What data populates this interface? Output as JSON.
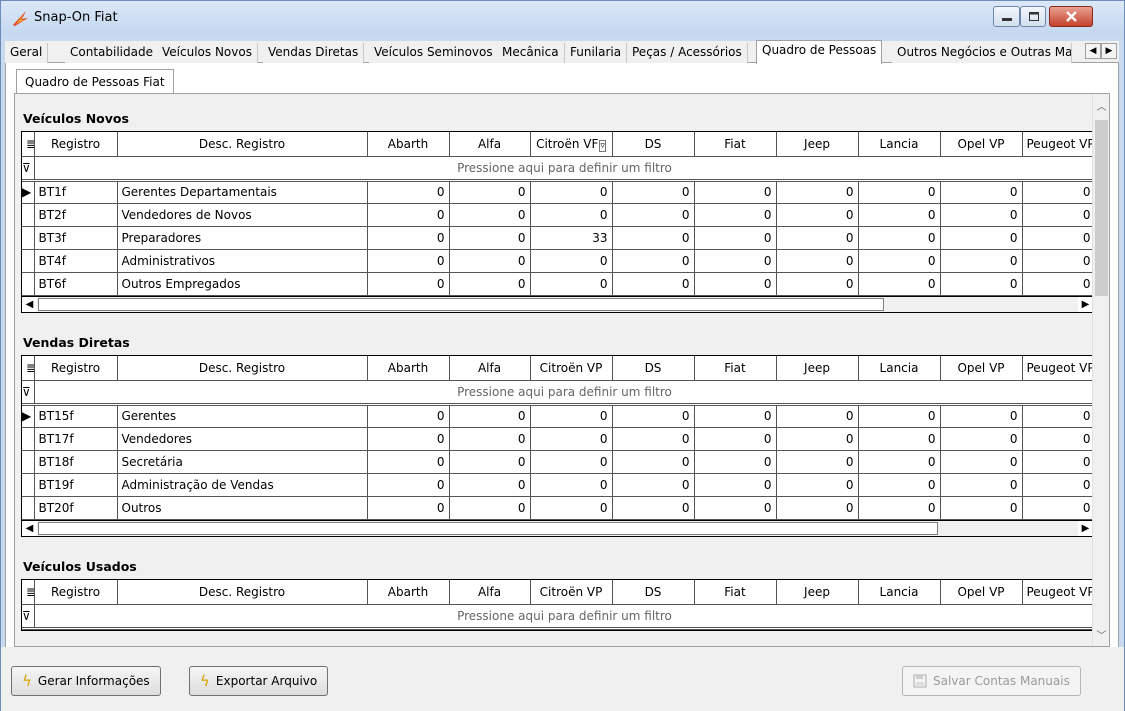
{
  "window": {
    "title": "Snap-On Fiat"
  },
  "tabs": [
    {
      "label": "Geral"
    },
    {
      "label": "Contabilidade"
    },
    {
      "label": "Veículos Novos"
    },
    {
      "label": "Vendas Diretas"
    },
    {
      "label": "Veículos Seminovos"
    },
    {
      "label": "Mecânica"
    },
    {
      "label": "Funilaria"
    },
    {
      "label": "Peças / Acessórios"
    },
    {
      "label": "Quadro de Pessoas"
    },
    {
      "label": "Outros Negócios e Outras Mai"
    }
  ],
  "active_tab": "Quadro de Pessoas",
  "subtab": {
    "label": "Quadro de Pessoas Fiat"
  },
  "grid": {
    "columns": [
      "Registro",
      "Desc. Registro",
      "Abarth",
      "Alfa",
      "Citroën VP",
      "DS",
      "Fiat",
      "Jeep",
      "Lancia",
      "Opel VP",
      "Peugeot VP"
    ],
    "column_truncated_with_filter": "Citroën VF",
    "filter_hint": "Pressione aqui para definir um filtro"
  },
  "sections": [
    {
      "title": "Veículos Novos",
      "rows": [
        {
          "reg": "BT1f",
          "desc": "Gerentes Departamentais",
          "values": [
            "0",
            "0",
            "0",
            "0",
            "0",
            "0",
            "0",
            "0",
            "0"
          ]
        },
        {
          "reg": "BT2f",
          "desc": "Vendedores de Novos",
          "values": [
            "0",
            "0",
            "0",
            "0",
            "0",
            "0",
            "0",
            "0",
            "0"
          ]
        },
        {
          "reg": "BT3f",
          "desc": "Preparadores",
          "values": [
            "0",
            "0",
            "33",
            "0",
            "0",
            "0",
            "0",
            "0",
            "0"
          ]
        },
        {
          "reg": "BT4f",
          "desc": "Administrativos",
          "values": [
            "0",
            "0",
            "0",
            "0",
            "0",
            "0",
            "0",
            "0",
            "0"
          ]
        },
        {
          "reg": "BT6f",
          "desc": "Outros Empregados",
          "values": [
            "0",
            "0",
            "0",
            "0",
            "0",
            "0",
            "0",
            "0",
            "0"
          ]
        }
      ]
    },
    {
      "title": "Vendas Diretas",
      "rows": [
        {
          "reg": "BT15f",
          "desc": "Gerentes",
          "values": [
            "0",
            "0",
            "0",
            "0",
            "0",
            "0",
            "0",
            "0",
            "0"
          ]
        },
        {
          "reg": "BT17f",
          "desc": "Vendedores",
          "values": [
            "0",
            "0",
            "0",
            "0",
            "0",
            "0",
            "0",
            "0",
            "0"
          ]
        },
        {
          "reg": "BT18f",
          "desc": "Secretária",
          "values": [
            "0",
            "0",
            "0",
            "0",
            "0",
            "0",
            "0",
            "0",
            "0"
          ]
        },
        {
          "reg": "BT19f",
          "desc": "Administração de Vendas",
          "values": [
            "0",
            "0",
            "0",
            "0",
            "0",
            "0",
            "0",
            "0",
            "0"
          ]
        },
        {
          "reg": "BT20f",
          "desc": "Outros",
          "values": [
            "0",
            "0",
            "0",
            "0",
            "0",
            "0",
            "0",
            "0",
            "0"
          ]
        }
      ]
    },
    {
      "title": "Veículos Usados",
      "rows": []
    }
  ],
  "footer": {
    "gerar_label": "Gerar Informações",
    "exportar_label": "Exportar Arquivo",
    "salvar_label": "Salvar Contas Manuais"
  },
  "icons": {
    "app": "snapon-flame-icon",
    "action": "lightning-bolt-icon",
    "save": "floppy-disk-icon"
  },
  "colors": {
    "titlebar": "#c4d7ef",
    "bolt": "#d9a400",
    "close_button": "#c4432b"
  }
}
